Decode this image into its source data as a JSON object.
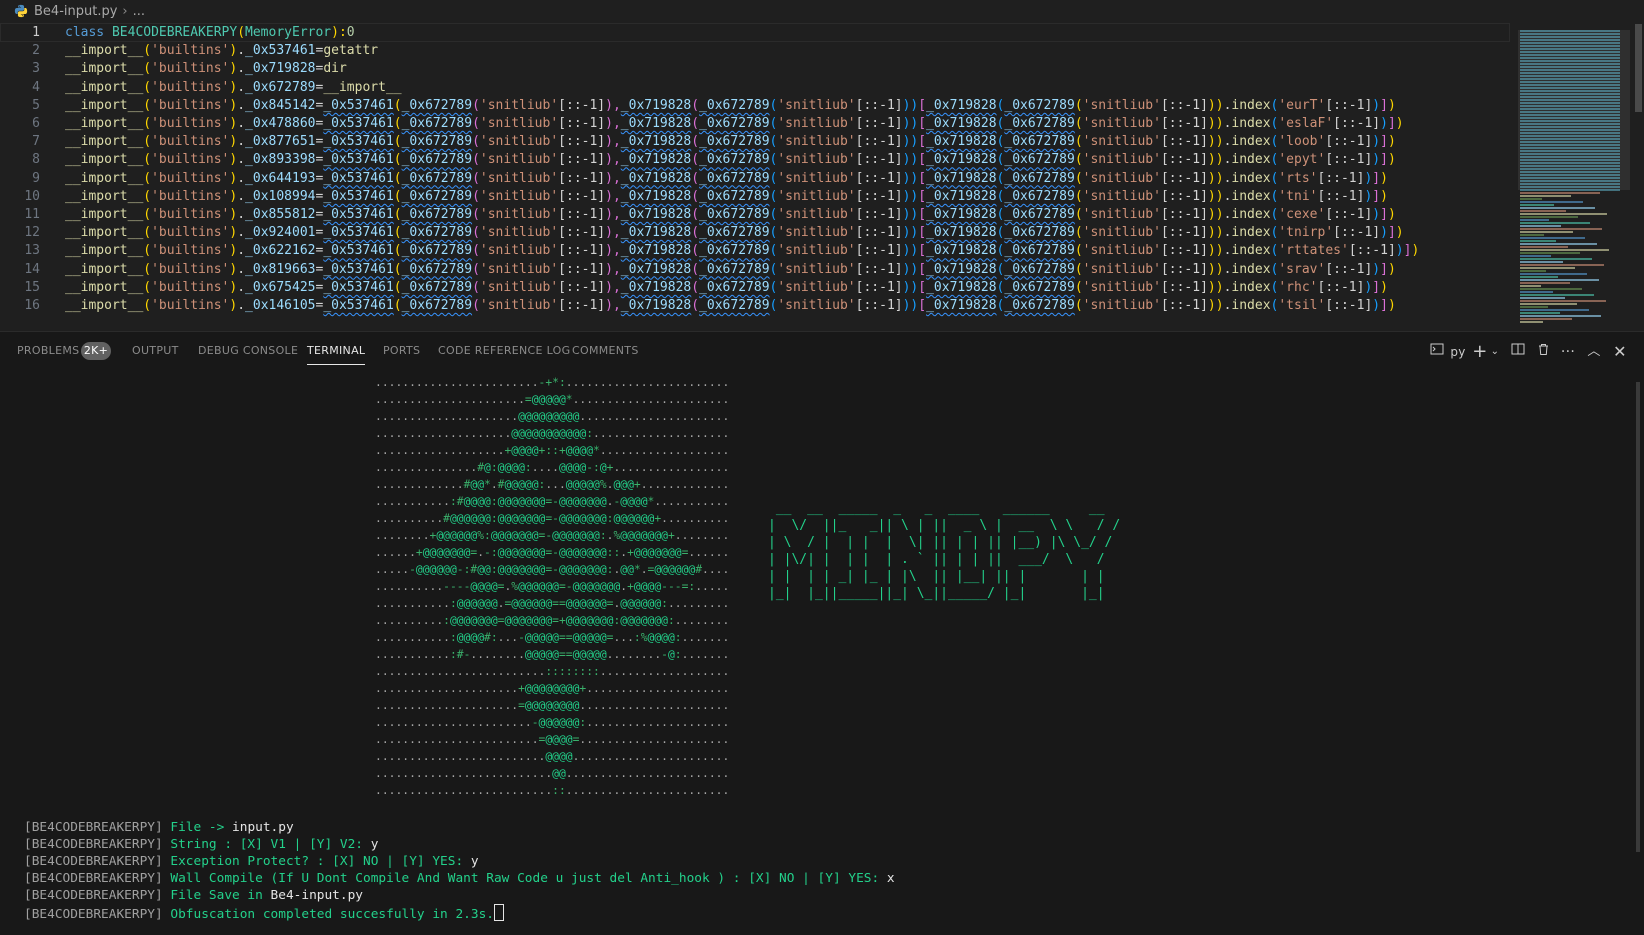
{
  "breadcrumb": {
    "file": "Be4-input.py",
    "more": "..."
  },
  "editor": {
    "lines": [
      {
        "n": "1"
      },
      {
        "n": "2"
      },
      {
        "n": "3"
      },
      {
        "n": "4"
      },
      {
        "n": "5"
      },
      {
        "n": "6"
      },
      {
        "n": "7"
      },
      {
        "n": "8"
      },
      {
        "n": "9"
      },
      {
        "n": "10"
      },
      {
        "n": "11"
      },
      {
        "n": "12"
      },
      {
        "n": "13"
      },
      {
        "n": "14"
      },
      {
        "n": "15"
      },
      {
        "n": "16"
      }
    ],
    "class_line": {
      "kw": "class",
      "name": "BE4CODEBREAKERPY",
      "base": "MemoryError",
      "val": "0"
    },
    "imp": "__import__",
    "builtins": "'builtins'",
    "assign_lines": [
      {
        "attr": "_0x537461",
        "val": "getattr"
      },
      {
        "attr": "_0x719828",
        "val": "dir"
      },
      {
        "attr": "_0x672789",
        "val": "__import__"
      }
    ],
    "call_lines": [
      {
        "attr": "_0x845142",
        "key": "'eurT'"
      },
      {
        "attr": "_0x478860",
        "key": "'eslaF'"
      },
      {
        "attr": "_0x877651",
        "key": "'loob'"
      },
      {
        "attr": "_0x893398",
        "key": "'epyt'"
      },
      {
        "attr": "_0x644193",
        "key": "'rts'"
      },
      {
        "attr": "_0x108994",
        "key": "'tni'"
      },
      {
        "attr": "_0x855812",
        "key": "'cexe'"
      },
      {
        "attr": "_0x924001",
        "key": "'tnirp'"
      },
      {
        "attr": "_0x622162",
        "key": "'rttates'"
      },
      {
        "attr": "_0x819663",
        "key": "'srav'"
      },
      {
        "attr": "_0x675425",
        "key": "'rhc'"
      },
      {
        "attr": "_0x146105",
        "key": "'tsil'"
      }
    ],
    "getattr_name": "_0x537461",
    "import_name": "_0x672789",
    "dir_name": "_0x719828",
    "snit": "'snitliub'",
    "slice": "[::-1]",
    "index": "index"
  },
  "panel": {
    "tabs": [
      "PROBLEMS",
      "OUTPUT",
      "DEBUG CONSOLE",
      "TERMINAL",
      "PORTS",
      "CODE REFERENCE LOG",
      "COMMENTS"
    ],
    "active_tab": "TERMINAL",
    "problems_badge": "2K+",
    "terminal_name": "py"
  },
  "terminal": {
    "art": [
      "........................-+*:........................",
      "......................=@@@@@*.......................",
      ".....................@@@@@@@@@......................",
      "....................@@@@@@@@@@@:....................",
      "...................+@@@@+::+@@@@*...................",
      "...............#@:@@@@:....@@@@-:@+.................",
      ".............#@@*.#@@@@@:...@@@@@%.@@@+.............",
      "...........:#@@@@:@@@@@@@=-@@@@@@@.-@@@@*...........",
      "..........#@@@@@@:@@@@@@@=-@@@@@@@:@@@@@@+..........",
      "........+@@@@@@%:@@@@@@@=-@@@@@@@:.%@@@@@@@+........",
      "......+@@@@@@@=.-:@@@@@@@=-@@@@@@@::.+@@@@@@@=......",
      ".....-@@@@@@-:#@@:@@@@@@@=-@@@@@@@:.@@*.=@@@@@@#....",
      "..........----@@@@=.%@@@@@@=-@@@@@@@.+@@@@---=:.....",
      "...........:@@@@@@.=@@@@@@==@@@@@@=.@@@@@@:.........",
      "..........:@@@@@@@=@@@@@@@=+@@@@@@@:@@@@@@@:........",
      "...........:@@@@#:...-@@@@@==@@@@@=...:%@@@@:.......",
      "...........:#-........@@@@@==@@@@@........-@:.......",
      ".........................::::::::...................",
      ".....................+@@@@@@@@+.....................",
      ".....................=@@@@@@@@......................",
      ".......................-@@@@@@:.....................",
      "........................=@@@@=......................",
      ".........................@@@@.......................",
      "..........................@@........................",
      "..........................::........................"
    ],
    "banner": [
      " __  __  _____  _   _  ____   ______     __",
      "|  \\/  ||_   _|| \\ | ||  _ \\ |  __  \\ \\   / /",
      "| \\  / |  | |  |  \\| || | | || |__) |\\ \\_/ / ",
      "| |\\/| |  | |  | . ` || | | ||  ___/  \\   /  ",
      "| |  | | _| |_ | |\\  || |__| || |       | |   ",
      "|_|  |_||_____||_| \\_||_____/ |_|       |_|   "
    ],
    "logs": [
      {
        "prefix": "[BE4CODEBREAKERPY]",
        "msg": "File ->",
        "val": "input.py"
      },
      {
        "prefix": "[BE4CODEBREAKERPY]",
        "msg": "String : [X] V1 | [Y] V2:",
        "val": "y"
      },
      {
        "prefix": "[BE4CODEBREAKERPY]",
        "msg": "Exception Protect? : [X] NO | [Y] YES:",
        "val": "y"
      },
      {
        "prefix": "[BE4CODEBREAKERPY]",
        "msg": "Wall Compile (If U Dont Compile And Want Raw Code u just del Anti_hook ) : [X] NO | [Y] YES:",
        "val": "x"
      },
      {
        "prefix": "[BE4CODEBREAKERPY]",
        "msg": "File Save in",
        "val": "Be4-input.py"
      },
      {
        "prefix": "[BE4CODEBREAKERPY]",
        "msg": "Obfuscation completed succesfully in 2.3s.",
        "val": ""
      }
    ]
  },
  "colors": {
    "terminal_green": "#23d18b",
    "editor_bg": "#1f1f1f",
    "panel_bg": "#181818"
  }
}
